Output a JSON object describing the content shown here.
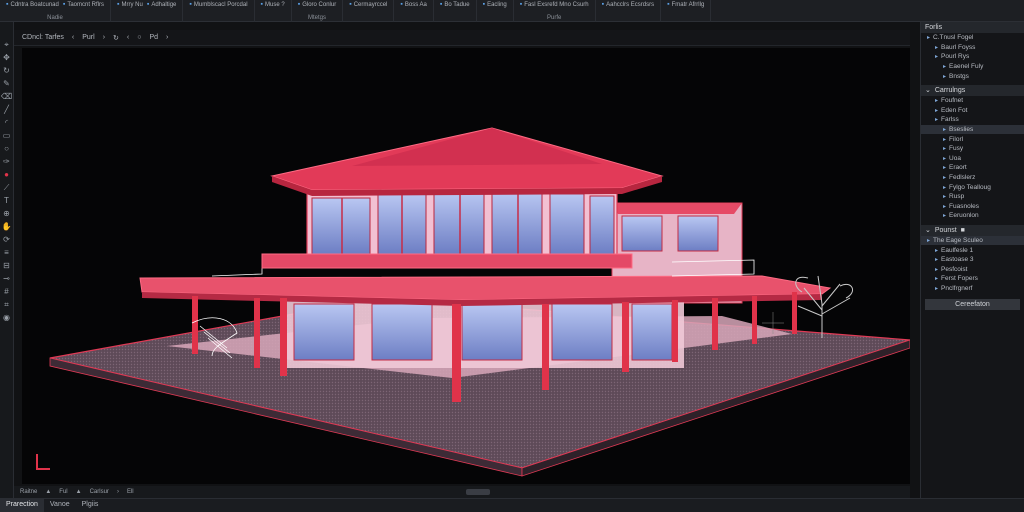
{
  "ribbon": {
    "groups": [
      {
        "buttons": [
          "Cdntra Boatcunad",
          "Taomcnt Rflrs"
        ],
        "label": "Nadie"
      },
      {
        "buttons": [
          "Mrry Nu",
          "Adhaltige"
        ],
        "label": ""
      },
      {
        "buttons": [
          "Mumblscacl Porcdal"
        ],
        "label": ""
      },
      {
        "buttons": [
          "Muse ?"
        ],
        "label": ""
      },
      {
        "buttons": [
          "Gloro Conlur"
        ],
        "label": "Mtetgs"
      },
      {
        "buttons": [
          "Cermayrccel"
        ],
        "label": ""
      },
      {
        "buttons": [
          "Boss Aa"
        ],
        "label": ""
      },
      {
        "buttons": [
          "Bo Tadue"
        ],
        "label": ""
      },
      {
        "buttons": [
          "Eacling"
        ],
        "label": ""
      },
      {
        "buttons": [
          "Fasl Exsrefd Mno Csurh"
        ],
        "label": "Purfe"
      },
      {
        "buttons": [
          "Aahcclrs Ecsrdsrs"
        ],
        "label": ""
      },
      {
        "buttons": [
          "Fmatr Afrrllg"
        ],
        "label": ""
      }
    ]
  },
  "viewport_bar": {
    "items": [
      "CDncl: Tarfes",
      "‹",
      "Purl",
      "›",
      "↻",
      "‹",
      "○",
      "Pd",
      "›"
    ]
  },
  "status_bar": {
    "items": [
      "Raitne",
      "▲",
      "Ful",
      "▲",
      "Carlsur",
      "›",
      "Ell"
    ]
  },
  "bottom_tabs": [
    "Prarection",
    "Vanoe",
    "Plgiis"
  ],
  "right_panel": {
    "header": "Forlis",
    "tree1": [
      {
        "text": "C.Tnusl Fogel",
        "indent": 0
      },
      {
        "text": "Baurl Foyss",
        "indent": 1
      },
      {
        "text": "Pourl Rys",
        "indent": 1
      },
      {
        "text": "Eaenel Fuly",
        "indent": 2
      },
      {
        "text": "Bnstgs",
        "indent": 2
      }
    ],
    "section2_title": "Carrulngs",
    "tree2": [
      {
        "text": "Foufnet",
        "indent": 1
      },
      {
        "text": "Eden Fot",
        "indent": 1
      },
      {
        "text": "Farlss",
        "indent": 1
      },
      {
        "text": "Bseslies",
        "indent": 2
      },
      {
        "text": "Filorl",
        "indent": 2
      },
      {
        "text": "Fusy",
        "indent": 2
      },
      {
        "text": "Uoa",
        "indent": 2
      },
      {
        "text": "Eraort",
        "indent": 2
      },
      {
        "text": "Fedlslerz",
        "indent": 2
      },
      {
        "text": "Fylgo Tealloug",
        "indent": 2
      },
      {
        "text": "Rusp",
        "indent": 2
      },
      {
        "text": "Fuasnoles",
        "indent": 2
      },
      {
        "text": "Eeruonlon",
        "indent": 2
      }
    ],
    "section3_title": "Pounst",
    "tree3": [
      {
        "text": "The Eage Sculeo",
        "indent": 0
      },
      {
        "text": "Eaulfesle 1",
        "indent": 1
      },
      {
        "text": "Eastoase 3",
        "indent": 1
      },
      {
        "text": "Pesfcoist",
        "indent": 1
      },
      {
        "text": "Ferst Fopers",
        "indent": 1
      },
      {
        "text": "Pnclfrgnerf",
        "indent": 1
      }
    ],
    "button": "Cereefaton"
  },
  "colors": {
    "accent": "#e0334a",
    "background": "#050506",
    "panel": "#141518"
  },
  "icons": [
    "select-icon",
    "move-icon",
    "rotate-icon",
    "pen-icon",
    "measure-icon",
    "layer-icon"
  ]
}
